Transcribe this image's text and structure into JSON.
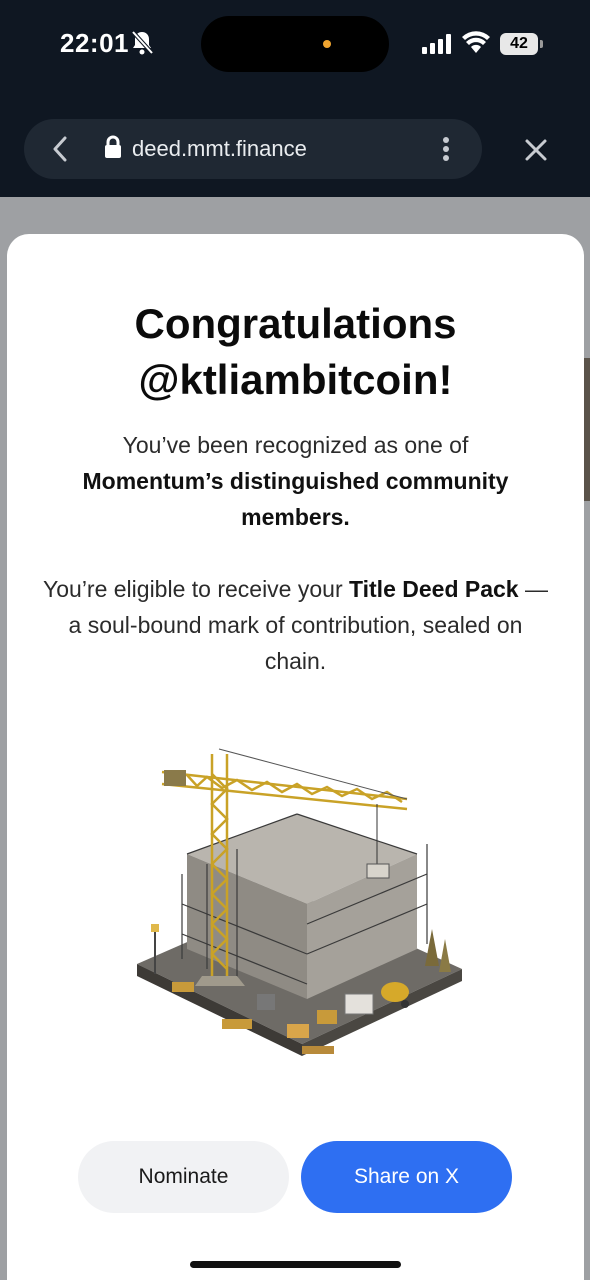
{
  "status_bar": {
    "time": "22:01",
    "battery": "42",
    "icons": [
      "bell-off-icon",
      "signal-icon",
      "wifi-icon",
      "battery-icon"
    ]
  },
  "browser": {
    "url": "deed.mmt.finance",
    "icons": [
      "back-chevron-icon",
      "lock-icon",
      "more-vertical-icon",
      "close-icon"
    ]
  },
  "modal": {
    "title_line1": "Congratulations",
    "title_line2": "@ktliambitcoin!",
    "p1_part1": "You’ve been recognized as one of",
    "p1_bold": "Momentum’s distinguished community members.",
    "p2_part1": "You’re eligible to receive your ",
    "p2_bold": "Title Deed Pack",
    "p2_part2": " — a soul-bound mark of contribution, sealed on chain.",
    "illustration": "construction-site-illustration",
    "nominate_label": "Nominate",
    "share_label": "Share on X"
  },
  "colors": {
    "accent": "#2e6ff2",
    "dark_bg": "#0f1722"
  }
}
